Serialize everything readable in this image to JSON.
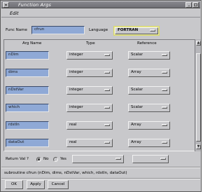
{
  "window": {
    "title": "Function Args"
  },
  "menu": {
    "items": [
      {
        "label": "Edit"
      }
    ]
  },
  "func_name": {
    "label": "Func Name",
    "value": "cfrun"
  },
  "language": {
    "label": "Language",
    "value": "FORTRAN"
  },
  "columns": {
    "arg_name": "Arg Name",
    "type": "Type",
    "reference": "Reference"
  },
  "rows": [
    {
      "name": "nDim",
      "type": "integer",
      "ref": "Scalar"
    },
    {
      "name": "dims",
      "type": "integer",
      "ref": "Array"
    },
    {
      "name": "nDstVar",
      "type": "integer",
      "ref": "Scalar"
    },
    {
      "name": "which",
      "type": "integer",
      "ref": "Scalar"
    },
    {
      "name": "rdstIn",
      "type": "real",
      "ref": "Array"
    },
    {
      "name": "dataOut",
      "type": "real",
      "ref": "Array"
    }
  ],
  "return_val": {
    "label": "Return Val ?",
    "no_label": "No",
    "yes_label": "Yes",
    "selected": "No"
  },
  "signature": "subroutine cfrun (nDim, dims, nDstVar, which, rdstIn, dataOut)",
  "buttons": {
    "ok": "OK",
    "apply": "Apply",
    "cancel": "Cancel"
  },
  "colors": {
    "field_bg": "#8fa9d6",
    "window_bg": "#c8c8cb",
    "language_highlight": "#ecec9a"
  }
}
